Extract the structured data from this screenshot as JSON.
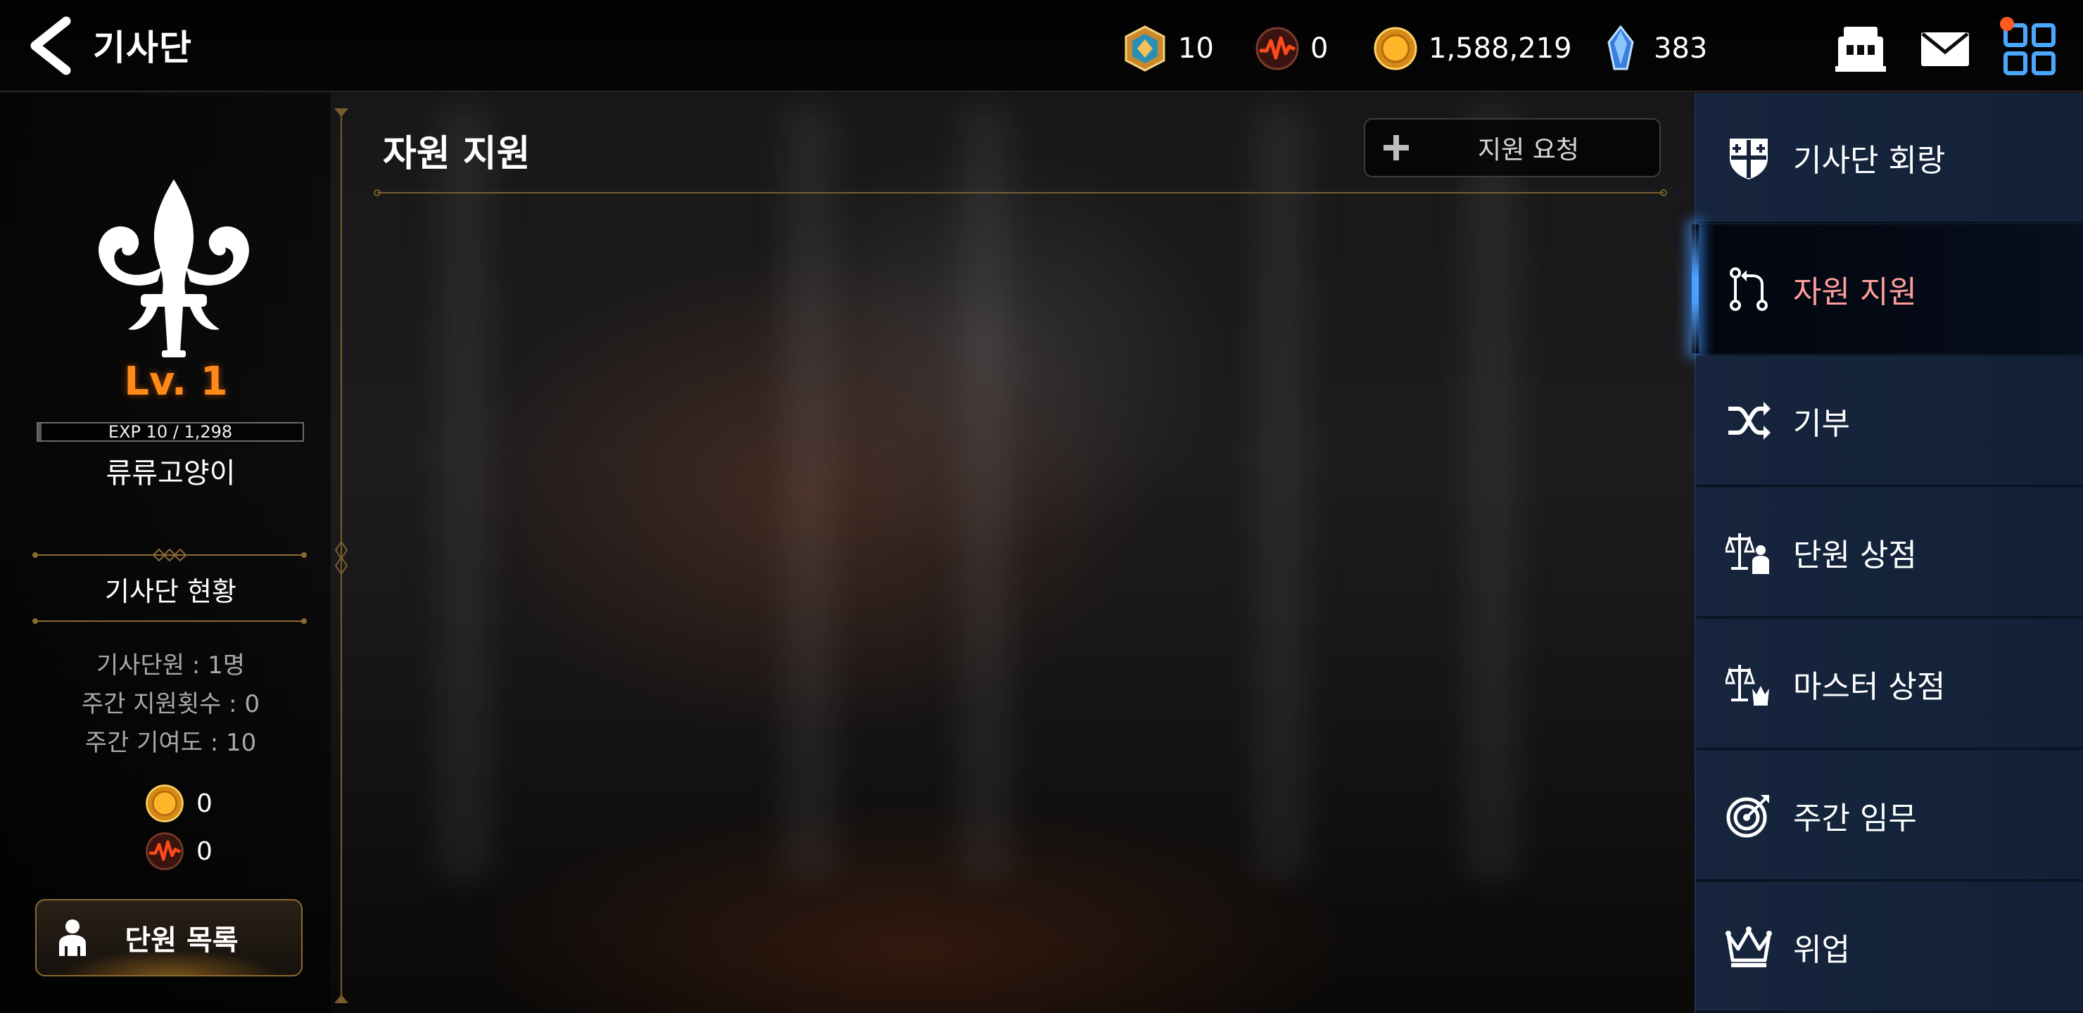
{
  "header": {
    "title": "기사단"
  },
  "currencies": [
    {
      "icon": "crest-token-icon",
      "value": "10"
    },
    {
      "icon": "flame-orb-icon",
      "value": "0"
    },
    {
      "icon": "gold-coin-icon",
      "value": "1,588,219"
    },
    {
      "icon": "blue-crystal-icon",
      "value": "383"
    }
  ],
  "top_icons": [
    "guild-hall-icon",
    "mail-icon",
    "grid-menu-icon"
  ],
  "guild": {
    "level": "Lv. 1",
    "exp_text": "EXP 10 / 1,298",
    "exp_fraction": 0.0077,
    "name": "류류고양이",
    "status_title": "기사단 현황",
    "stats": [
      "기사단원 : 1명",
      "주간 지원횟수 : 0",
      "주간 기여도 : 10"
    ],
    "resources": [
      {
        "icon": "gold-coin-icon",
        "value": "0"
      },
      {
        "icon": "flame-orb-icon",
        "value": "0"
      }
    ],
    "member_button": "단원 목록"
  },
  "content": {
    "title": "자원 지원",
    "request_button": "지원 요청"
  },
  "menu": {
    "active_index": 1,
    "items": [
      {
        "label": "기사단 회랑",
        "icon": "shield-icon"
      },
      {
        "label": "자원 지원",
        "icon": "resource-transfer-icon"
      },
      {
        "label": "기부",
        "icon": "shuffle-icon"
      },
      {
        "label": "단원 상점",
        "icon": "member-shop-icon"
      },
      {
        "label": "마스터 상점",
        "icon": "master-shop-icon"
      },
      {
        "label": "주간 임무",
        "icon": "target-icon"
      },
      {
        "label": "위업",
        "icon": "crown-icon"
      }
    ]
  },
  "colors": {
    "level": "#ff8a1a",
    "active_menu_text": "#ff9d9d",
    "notification": "#ff5a1f",
    "menu_bg": "#14233a"
  }
}
